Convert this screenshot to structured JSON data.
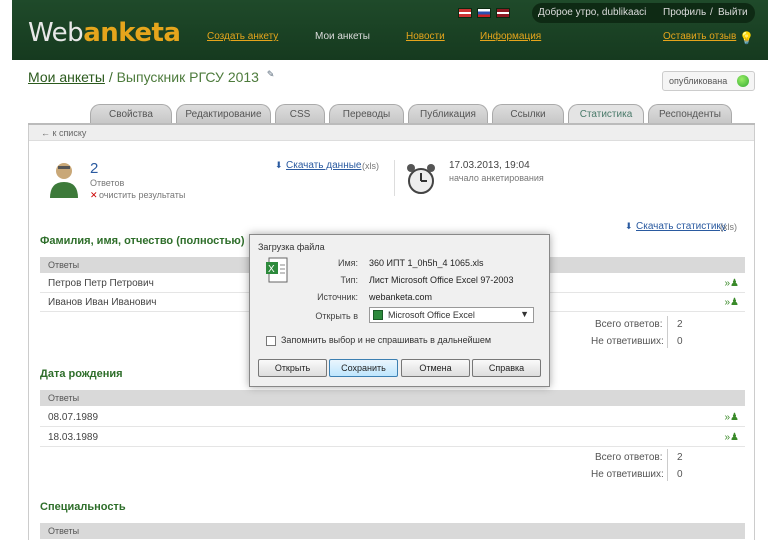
{
  "header": {
    "logo_part1": "Web",
    "logo_part2": "anketa",
    "nav": [
      "Создать анкету",
      "Мои анкеты",
      "Новости",
      "Информация"
    ],
    "greeting": "Доброе утро, dublikaaci",
    "profile": "Профиль",
    "separator": "/",
    "logout": "Выйти",
    "feedback": "Оставить отзыв"
  },
  "page": {
    "breadcrumb_link": "Мои анкеты",
    "breadcrumb_sep": "/",
    "title": "Выпускник РГСУ 2013",
    "edit_mark": "✎",
    "published_label": "опубликована",
    "tabs": [
      "Свойства",
      "Редактирование",
      "CSS",
      "Переводы",
      "Публикация",
      "Ссылки",
      "Статистика",
      "Респонденты"
    ],
    "active_tab": "Статистика",
    "back_link": "← к списку"
  },
  "stats": {
    "count": "2",
    "count_label": "Ответов",
    "clear_label": "очистить результаты",
    "download_data": "Скачать данные",
    "download_data_fmt": "(xls)",
    "datetime": "17.03.2013, 19:04",
    "datetime_label": "начало анкетирования",
    "download_stats": "Скачать статистику",
    "download_stats_fmt": "(xls)"
  },
  "sections": [
    {
      "title": "Фамилия, имя, отчество (полностью)",
      "header": "Ответы",
      "rows": [
        "Петров Петр Петрович",
        "Иванов Иван Иванович"
      ],
      "total_label": "Всего ответов:",
      "total": "2",
      "skip_label": "Не ответивших:",
      "skip": "0"
    },
    {
      "title": "Дата рождения",
      "header": "Ответы",
      "rows": [
        "08.07.1989",
        "18.03.1989"
      ],
      "total_label": "Всего ответов:",
      "total": "2",
      "skip_label": "Не ответивших:",
      "skip": "0"
    },
    {
      "title": "Специальность",
      "header": "Ответы"
    }
  ],
  "dialog": {
    "title": "Загрузка файла",
    "name_label": "Имя:",
    "name_value": "360 ИПТ 1_0h5h_4 1065.xls",
    "type_label": "Тип:",
    "type_value": "Лист Microsoft Office Excel 97-2003",
    "source_label": "Источник:",
    "source_value": "webanketa.com",
    "open_with_label": "Открыть в",
    "open_with_value": "Microsoft Office Excel",
    "remember_label": "Запомнить выбор и не спрашивать в дальнейшем",
    "buttons": [
      "Открыть",
      "Сохранить",
      "Отмена",
      "Справка"
    ]
  },
  "colors": {
    "header_bg": "#1f4a2a",
    "accent": "#e6a51c",
    "section_title": "#2e6e2a",
    "link": "#2a5aa0"
  }
}
